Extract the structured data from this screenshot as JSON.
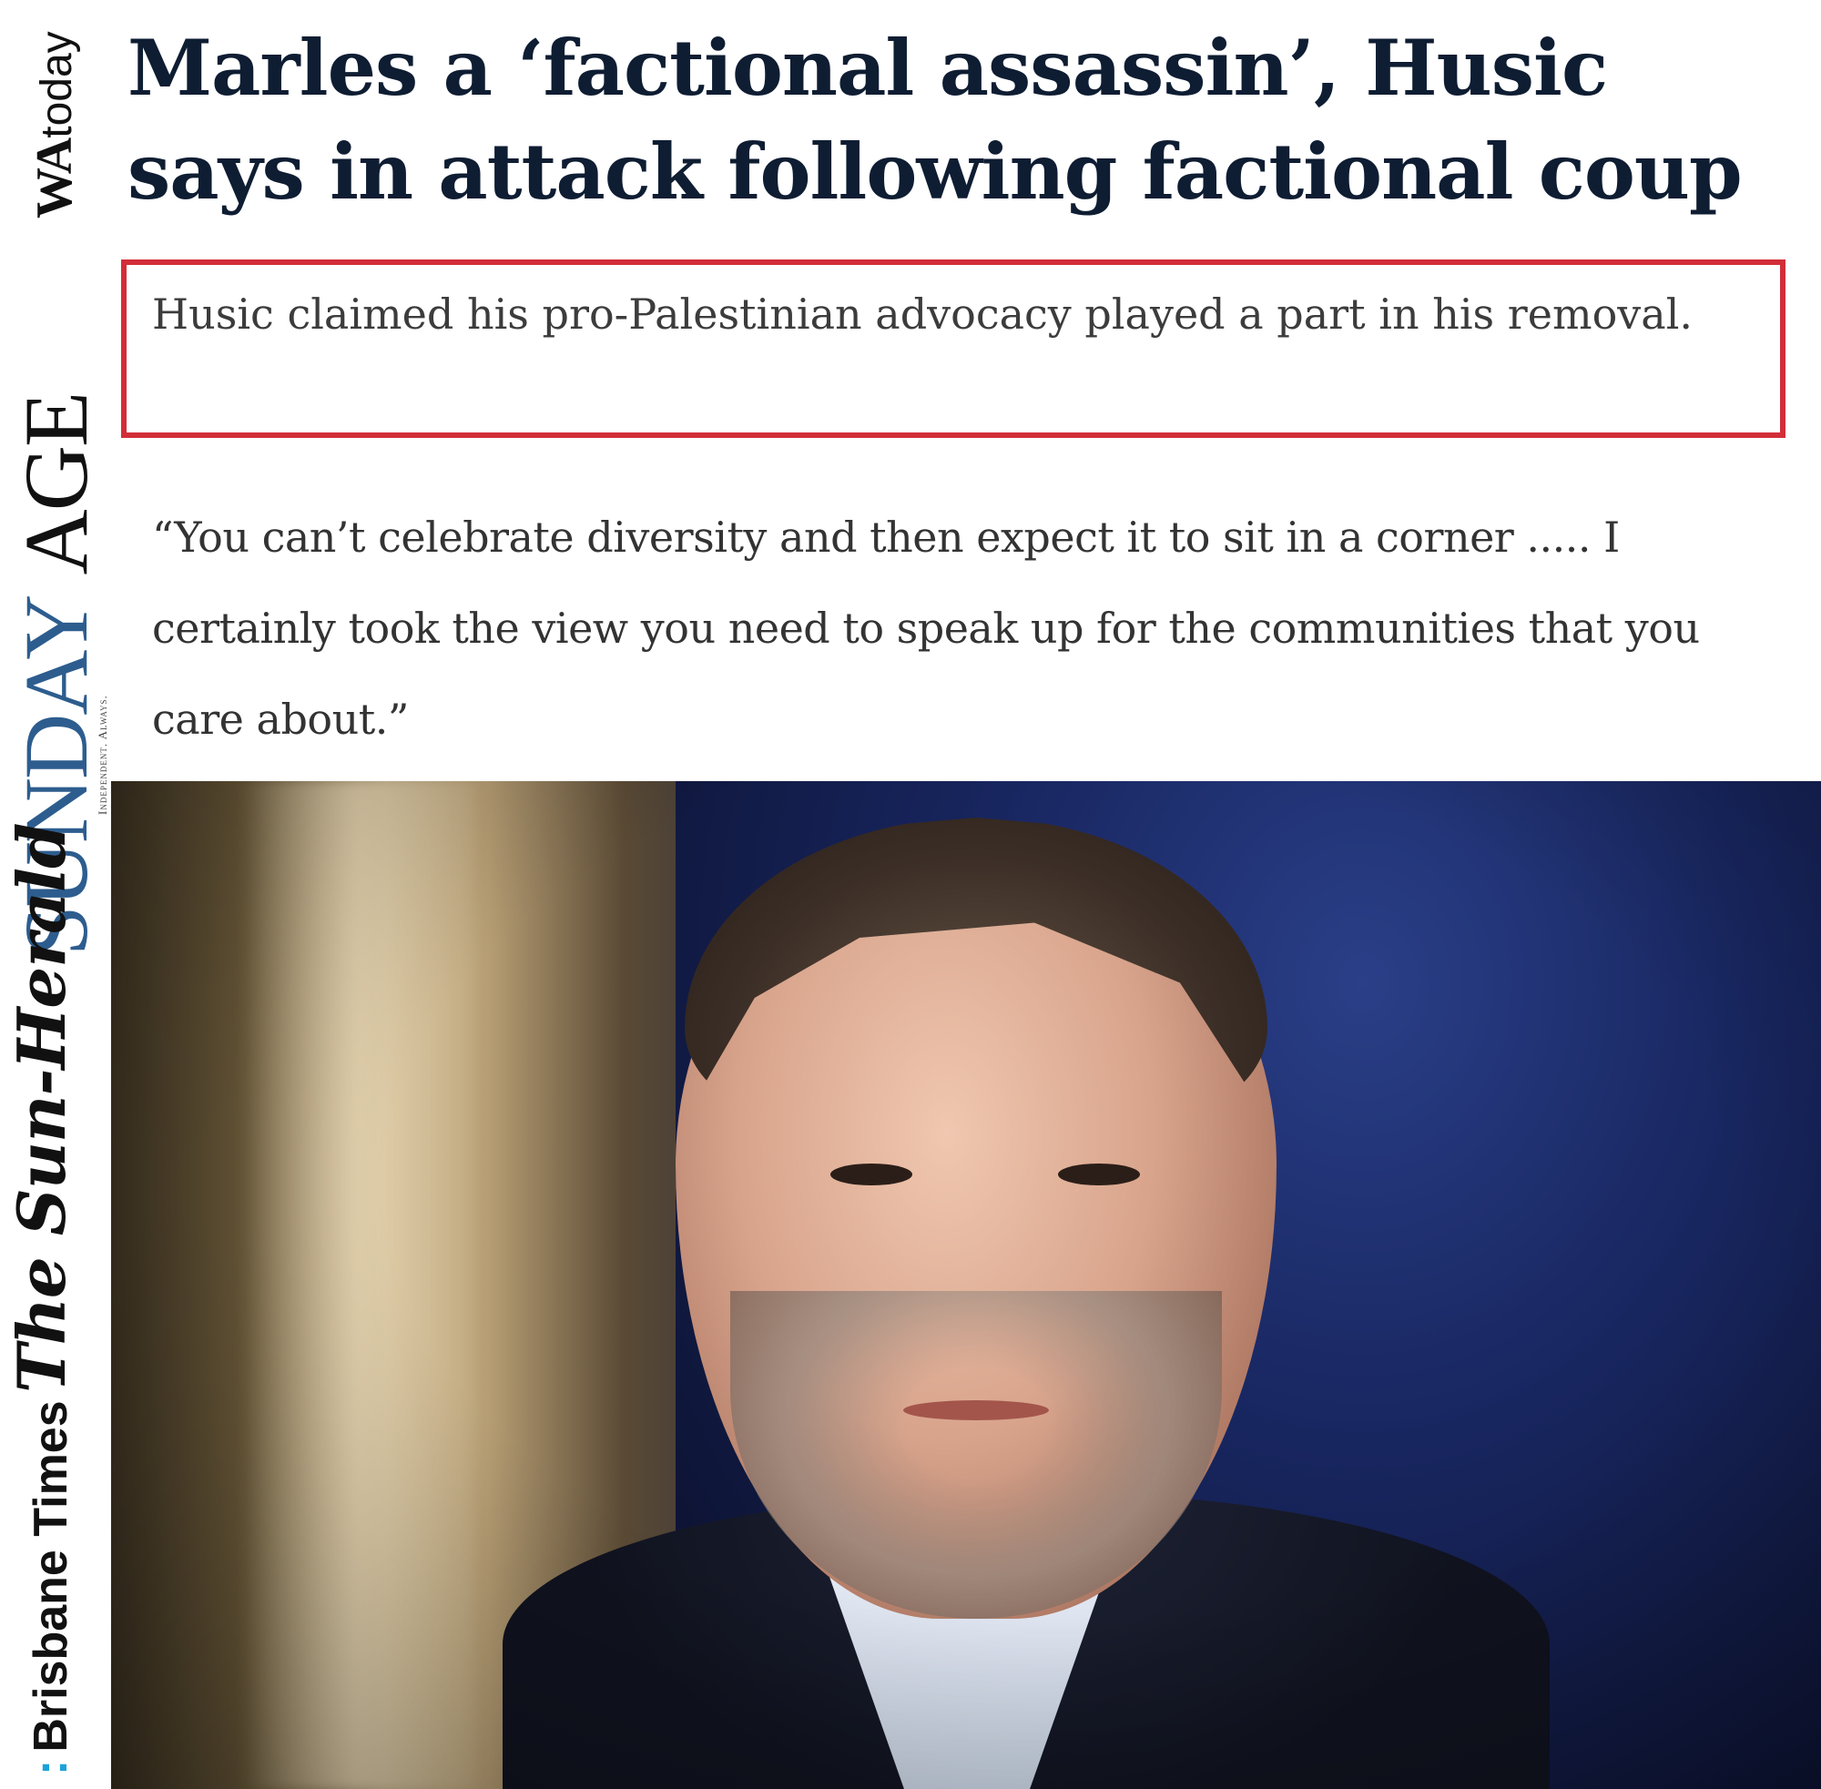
{
  "mastheads": {
    "watoday": {
      "wa": "WA",
      "today": "today"
    },
    "sunday_age": {
      "sunday": "SUNDAY",
      "age": "AGE",
      "tagline": "Independent. Always."
    },
    "sun_herald": "The Sun-Herald",
    "brisbane_times": {
      "mark": ":",
      "name": "Brisbane Times"
    }
  },
  "article": {
    "headline": "Marles a ‘factional assassin’, Husic says in attack following factional coup",
    "subhead": "Husic claimed his pro-Palestinian advocacy played a part in his removal.",
    "quote": "“You can’t celebrate diversity and then expect it to sit in a corner ..... I certainly took the view you need to speak up for the communities that you care about.”"
  },
  "colors": {
    "highlight_border": "#d22e3a",
    "headline_text": "#0f1d33",
    "sunday_blue": "#2d5d8f",
    "brisbane_accent": "#1aa3d9"
  }
}
